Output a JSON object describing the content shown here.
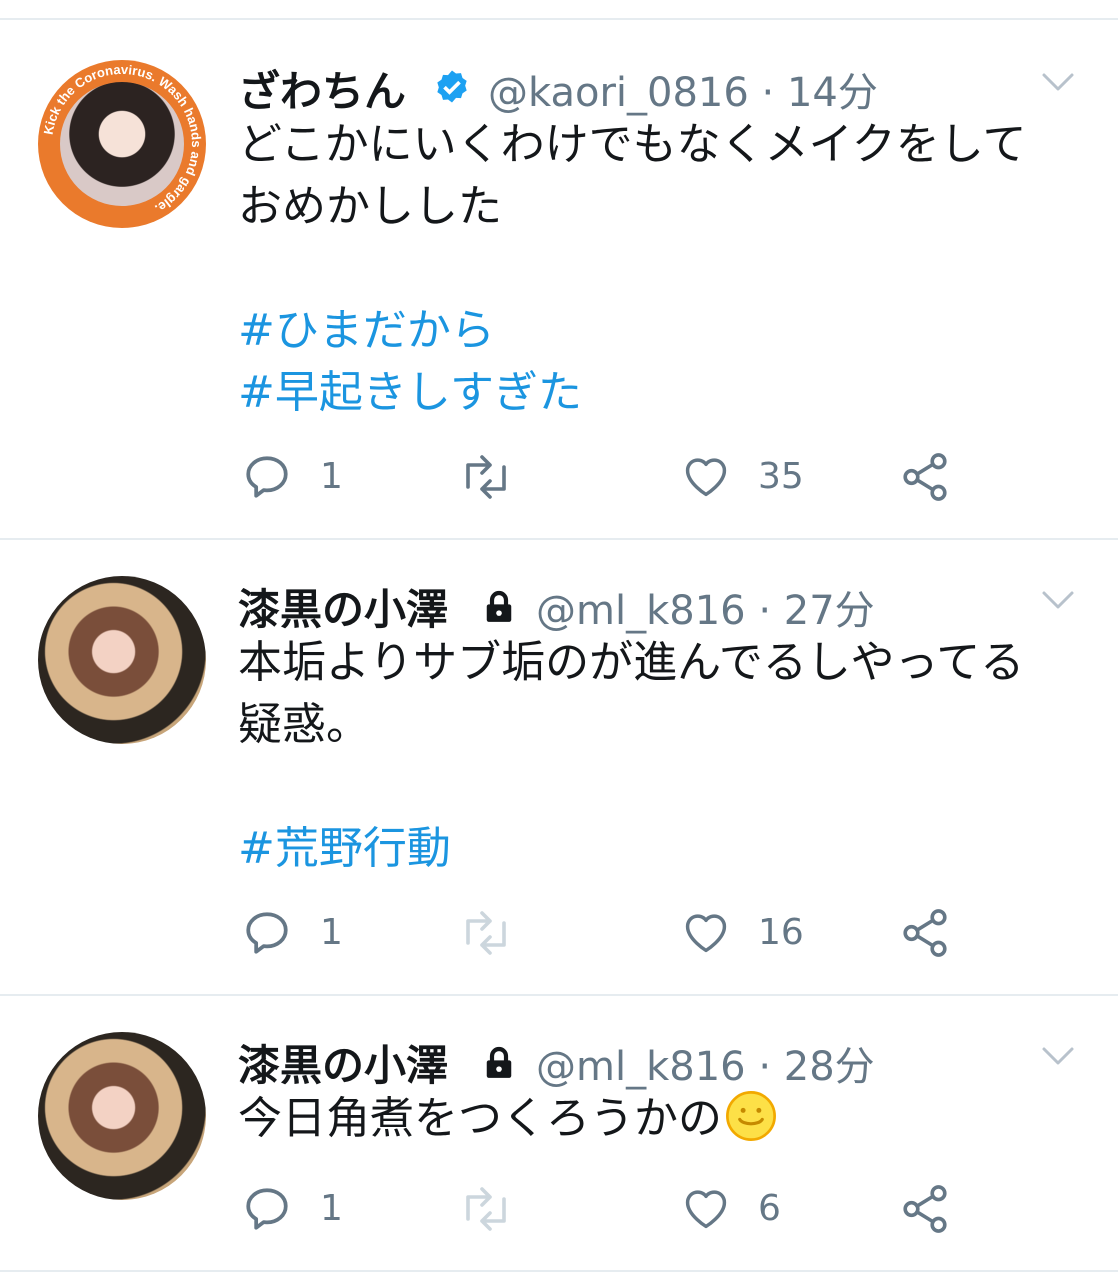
{
  "colors": {
    "accent": "#1b95e0",
    "secondary_text": "#657786",
    "verified": "#1da1f2",
    "divider": "#e6ecf0"
  },
  "tweets": [
    {
      "display_name": "ざわちん",
      "badge": "verified-badge-icon",
      "handle": "@kaori_0816",
      "separator": "·",
      "time": "14分",
      "body_lines": [
        "どこかにいくわけでもなくメイクをして",
        "おめかしした"
      ],
      "hashtags": [
        "#ひまだから",
        "#早起きしすぎた"
      ],
      "avatar_text": "Kick the Coronavirus. Wash hands and gargle.",
      "replies": "1",
      "likes": "35"
    },
    {
      "display_name": "漆黒の小澤",
      "badge": "lock-icon",
      "handle": "@ml_k816",
      "separator": "·",
      "time": "27分",
      "body_lines": [
        "本垢よりサブ垢のが進んでるしやってる",
        "疑惑。"
      ],
      "hashtags": [
        "#荒野行動"
      ],
      "replies": "1",
      "likes": "16"
    },
    {
      "display_name": "漆黒の小澤",
      "badge": "lock-icon",
      "handle": "@ml_k816",
      "separator": "·",
      "time": "28分",
      "body_lines": [
        "今日角煮をつくろうかの"
      ],
      "emoji": "smiley-emoji-icon",
      "hashtags": [],
      "replies": "1",
      "likes": "6"
    }
  ]
}
